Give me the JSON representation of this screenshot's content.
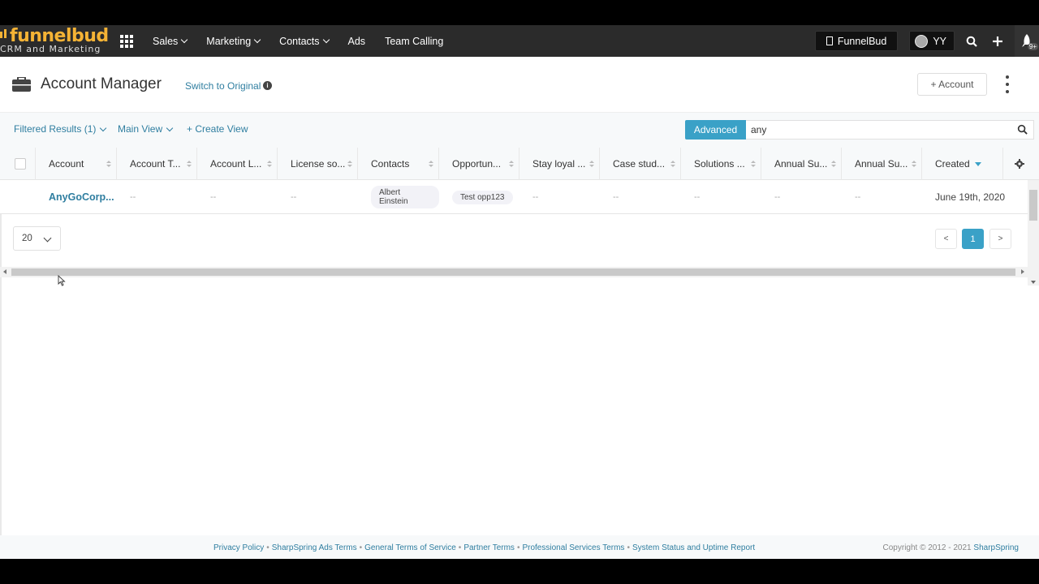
{
  "brand": {
    "name": "funnelbud",
    "tagline": "CRM and Marketing",
    "color": "#f5b335"
  },
  "nav": {
    "items": [
      {
        "label": "Sales",
        "dropdown": true
      },
      {
        "label": "Marketing",
        "dropdown": true
      },
      {
        "label": "Contacts",
        "dropdown": true
      },
      {
        "label": "Ads",
        "dropdown": false
      },
      {
        "label": "Team Calling",
        "dropdown": false
      }
    ],
    "company_button": "FunnelBud",
    "user_initials": "YY",
    "notification_badge": "9+"
  },
  "page": {
    "title": "Account Manager",
    "switch_link": "Switch to Original",
    "add_button": "+ Account"
  },
  "toolbar": {
    "filtered_results": "Filtered Results (1)",
    "main_view": "Main View",
    "create_view": "+ Create View",
    "advanced_label": "Advanced",
    "search_value": "any"
  },
  "table": {
    "columns": [
      "Account",
      "Account T...",
      "Account L...",
      "License so...",
      "Contacts",
      "Opportun...",
      "Stay loyal ...",
      "Case stud...",
      "Solutions ...",
      "Annual Su...",
      "Annual Su...",
      "Created"
    ],
    "rows": [
      {
        "account": "AnyGoCorp...",
        "account_type": "--",
        "account_l": "--",
        "license": "--",
        "contact": "Albert Einstein",
        "opportunity": "Test opp123",
        "stay_loyal": "--",
        "case_study": "--",
        "solutions": "--",
        "annual_1": "--",
        "annual_2": "--",
        "created": "June 19th, 2020"
      }
    ]
  },
  "pagination": {
    "page_size": "20",
    "prev": "<",
    "current": "1",
    "next": ">"
  },
  "footer": {
    "links": [
      "Privacy Policy",
      "SharpSpring Ads Terms",
      "General Terms of Service",
      "Partner Terms",
      "Professional Services Terms",
      "System Status and Uptime Report"
    ],
    "separator": "•",
    "copyright_prefix": "Copyright © 2012 - 2021",
    "copyright_company": "SharpSpring"
  },
  "colors": {
    "accent": "#3aa1c7",
    "link": "#2f7ea0",
    "nav_bg": "#2b2b2b"
  }
}
